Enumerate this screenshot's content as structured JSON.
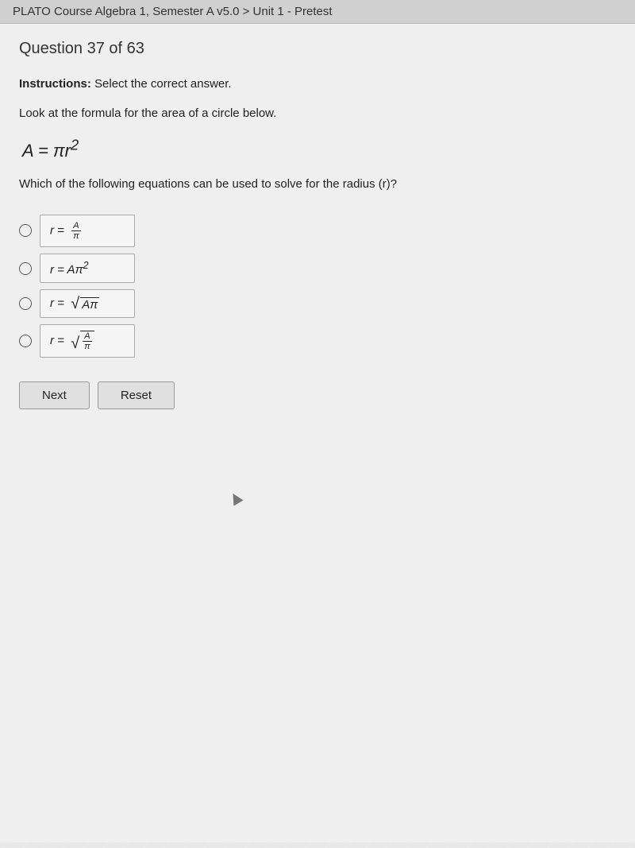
{
  "header": {
    "text": "PLATO Course Algebra 1, Semester A v5.0 > Unit 1 - Pretest"
  },
  "question": {
    "number": "Question 37 of 63",
    "instructions_label": "Instructions:",
    "instructions_text": " Select the correct answer.",
    "problem_text": "Look at the formula for the area of a circle below.",
    "formula": "A = πr²",
    "question_text": "Which of the following equations can be used to solve for the radius (r)?",
    "options": [
      {
        "id": "A",
        "label": "r = A/π"
      },
      {
        "id": "B",
        "label": "r = Aπ²"
      },
      {
        "id": "C",
        "label": "r = √(Aπ)"
      },
      {
        "id": "D",
        "label": "r = √(A/π)"
      }
    ]
  },
  "buttons": {
    "next_label": "Next",
    "reset_label": "Reset"
  }
}
